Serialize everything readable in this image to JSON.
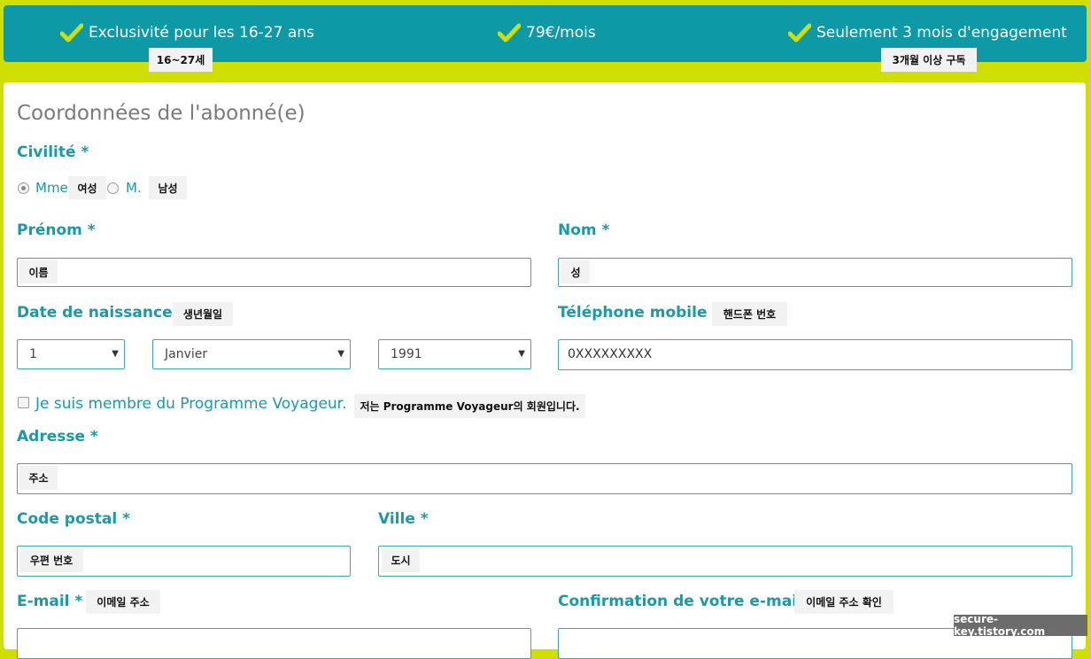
{
  "banner": {
    "features": [
      {
        "label": "Exclusivité pour les 16-27 ans",
        "note": "16~27세"
      },
      {
        "label": "79€/mois"
      },
      {
        "label": "Seulement 3 mois d'engagement",
        "note": "3개월 이상 구독"
      }
    ],
    "check_icon": "checkmark-icon",
    "accent": "#0d99a5",
    "check_color": "#cfe000"
  },
  "form": {
    "title": "Coordonnées de l'abonné(e)",
    "civilite": {
      "label": "Civilité *",
      "options": [
        {
          "label": "Mme",
          "note": "여성",
          "selected": true
        },
        {
          "label": "M.",
          "note": "남성",
          "selected": false
        }
      ]
    },
    "prenom": {
      "label": "Prénom *",
      "note": "이름"
    },
    "nom": {
      "label": "Nom *",
      "note": "성"
    },
    "naissance": {
      "label": "Date de naissance *",
      "note": "생년월일",
      "day": "1",
      "month": "Janvier",
      "year": "1991"
    },
    "telephone": {
      "label": "Téléphone mobile *",
      "note": "핸드폰 번호",
      "value": "0XXXXXXXXX"
    },
    "voyageur": {
      "label": "Je suis membre du Programme Voyageur.",
      "note": "저는 Programme Voyageur의 회원입니다."
    },
    "adresse": {
      "label": "Adresse *",
      "note": "주소"
    },
    "code_postal": {
      "label": "Code postal *",
      "note": "우편 번호"
    },
    "ville": {
      "label": "Ville *",
      "note": "도시"
    },
    "email": {
      "label": "E-mail *",
      "note": "이메일 주소"
    },
    "email_confirm": {
      "label": "Confirmation de votre e-mail *",
      "note": "이메일 주소 확인"
    }
  },
  "watermark": "secure-key.tistory.com"
}
